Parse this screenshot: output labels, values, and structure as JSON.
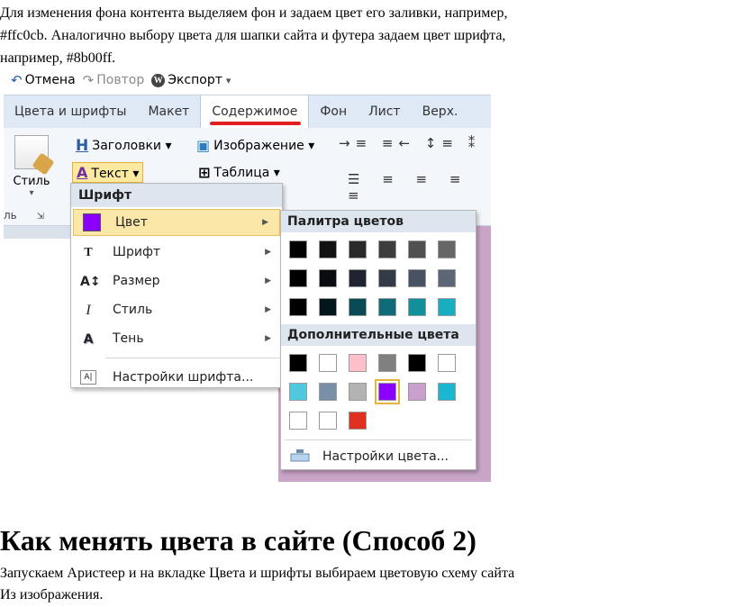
{
  "intro_lines": [
    "Для изменения фона контента выделяем фон и задаем цвет его заливки, например,",
    "#ffc0cb. Аналогично выбору цвета для шапки сайта и футера задаем цвет шрифта,",
    "например, #8b00ff."
  ],
  "qat": {
    "undo": "Отмена",
    "redo": "Повтор",
    "export": "Экспорт",
    "export_arrow": "▾",
    "undo_icon": "undo-icon",
    "redo_icon": "redo-icon"
  },
  "tabs": [
    "Цвета и шрифты",
    "Макет",
    "Содержимое",
    "Фон",
    "Лист",
    "Верх."
  ],
  "active_tab": "Содержимое",
  "ribbon": {
    "style_label": "Стиль",
    "style_arrow": "▾",
    "group_label": "ль",
    "headings": "Заголовки ▾",
    "text": "Текст ▾",
    "image": "Изображение ▾",
    "table": "Таблица ▾"
  },
  "font_menu": {
    "header": "Шрифт",
    "items": [
      {
        "label": "Цвет",
        "icon": "color-swatch-icon"
      },
      {
        "label": "Шрифт",
        "icon": "font-icon"
      },
      {
        "label": "Размер",
        "icon": "font-size-icon"
      },
      {
        "label": "Стиль",
        "icon": "italic-icon"
      },
      {
        "label": "Тень",
        "icon": "shadow-icon"
      }
    ],
    "settings": "Настройки шрифта..."
  },
  "color_menu": {
    "palette_header": "Палитра цветов",
    "palette": [
      "#000000",
      "#121212",
      "#2a2a2a",
      "#3d3d3d",
      "#505050",
      "#666666",
      "#000000",
      "#0b0b12",
      "#1f2430",
      "#343b48",
      "#485262",
      "#5c6676",
      "#000000",
      "#03161b",
      "#0a4a55",
      "#0f6b78",
      "#11909c",
      "#17aec0"
    ],
    "extra_header": "Дополнительные цвета",
    "extra": [
      "#000000",
      "#ffffff",
      "#ffc0cb",
      "#808080",
      "#000000",
      "#ffffff",
      "#4fc8e0",
      "#7a8fa8",
      "#b3b3b3",
      "#8b00ff",
      "#c9a0cd",
      "#1ab8d0",
      "#ffffff",
      "#ffffff",
      "#e03020"
    ],
    "picked_color": "#8b00ff",
    "settings": "Настройки цвета..."
  },
  "accent_color": "#e02020",
  "content_background": "#c9a4c7",
  "heading": "Как менять цвета в сайте (Способ 2)",
  "outro_lines": [
    "Запускаем Аристеер и на вкладке Цвета и шрифты выбираем цветовую схему сайта",
    "Из изображения."
  ]
}
